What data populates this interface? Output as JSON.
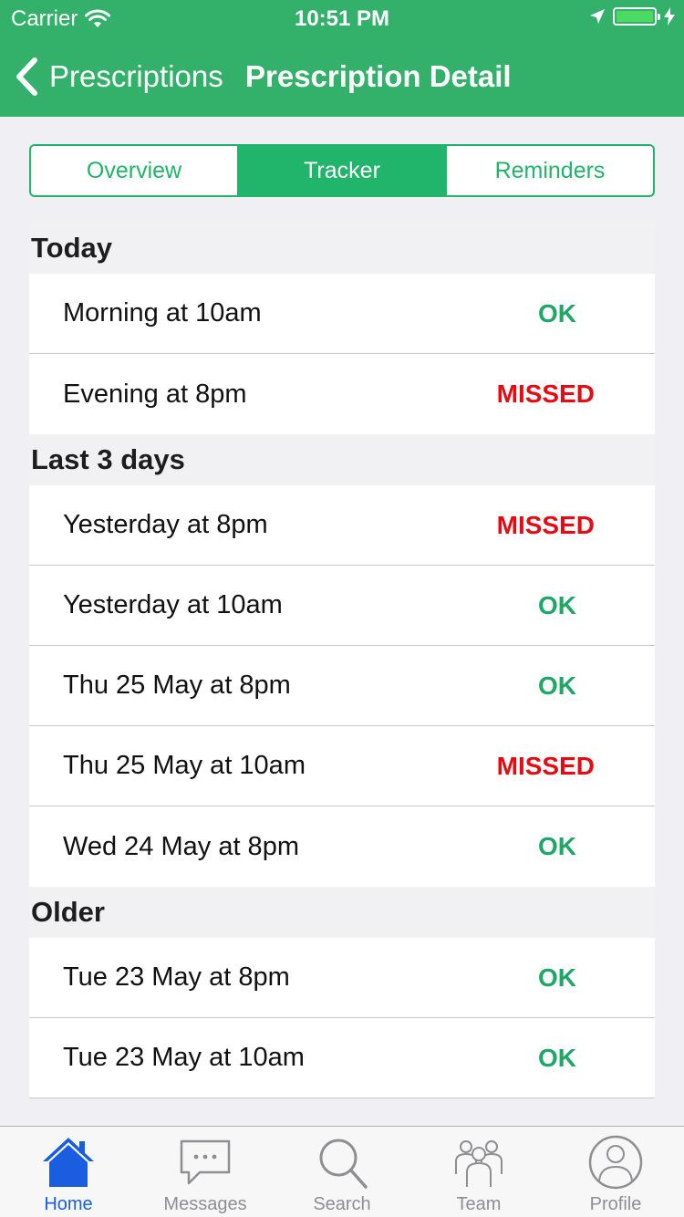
{
  "status_bar": {
    "carrier": "Carrier",
    "time": "10:51 PM"
  },
  "nav": {
    "back_label": "Prescriptions",
    "title": "Prescription Detail"
  },
  "segments": [
    {
      "label": "Overview",
      "active": false
    },
    {
      "label": "Tracker",
      "active": true
    },
    {
      "label": "Reminders",
      "active": false
    }
  ],
  "sections": [
    {
      "title": "Today",
      "rows": [
        {
          "label": "Morning at 10am",
          "status": "OK"
        },
        {
          "label": "Evening at 8pm",
          "status": "MISSED"
        }
      ]
    },
    {
      "title": "Last 3 days",
      "rows": [
        {
          "label": "Yesterday at 8pm",
          "status": "MISSED"
        },
        {
          "label": "Yesterday at 10am",
          "status": "OK"
        },
        {
          "label": "Thu 25 May at 8pm",
          "status": "OK"
        },
        {
          "label": "Thu 25 May at 10am",
          "status": "MISSED"
        },
        {
          "label": "Wed 24 May at 8pm",
          "status": "OK"
        }
      ]
    },
    {
      "title": "Older",
      "rows": [
        {
          "label": "Tue 23 May at 8pm",
          "status": "OK"
        },
        {
          "label": "Tue 23 May at 10am",
          "status": "OK"
        }
      ]
    }
  ],
  "tab_bar": [
    {
      "label": "Home",
      "icon": "home-icon",
      "active": true
    },
    {
      "label": "Messages",
      "icon": "messages-icon",
      "active": false
    },
    {
      "label": "Search",
      "icon": "search-icon",
      "active": false
    },
    {
      "label": "Team",
      "icon": "team-icon",
      "active": false
    },
    {
      "label": "Profile",
      "icon": "profile-icon",
      "active": false
    }
  ],
  "colors": {
    "header": "#33b06a",
    "accent": "#21b46b",
    "ok": "#1ea765",
    "missed": "#e40b14",
    "tab_active": "#1a5dde",
    "tab_inactive": "#8e8e93"
  }
}
